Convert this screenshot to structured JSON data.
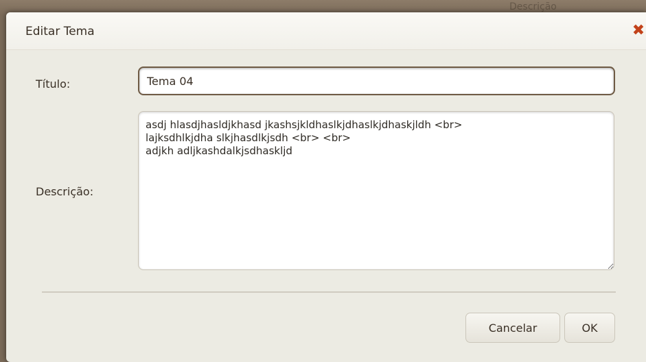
{
  "background": {
    "partial_text": "Descrição"
  },
  "dialog": {
    "title": "Editar Tema",
    "close_icon": "close-icon",
    "close_symbol": "✖",
    "fields": {
      "title_label": "Título:",
      "title_value": "Tema 04",
      "description_label": "Descrição:",
      "description_value": "asdj hlasdjhasldjkhasd jkashsjkldhaslkjdhaslkjdhaskjldh <br>\nlajksdhlkjdha slkjhasdlkjsdh <br> <br>\nadjkh adljkashdalkjsdhaskljd"
    },
    "buttons": {
      "cancel_label": "Cancelar",
      "ok_label": "OK"
    }
  },
  "colors": {
    "dialog_background": "#ecebe3",
    "close_icon": "#c2421a",
    "input_border_focused": "#6e5a44",
    "page_background": "#7a6a58"
  }
}
